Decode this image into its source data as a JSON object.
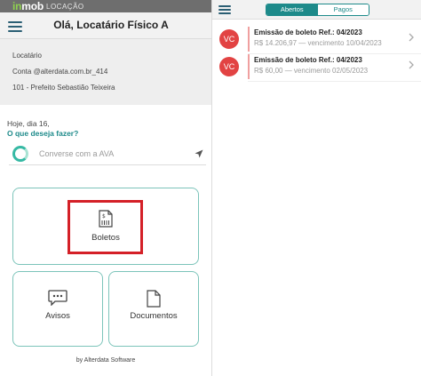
{
  "brand": {
    "logo_prefix": "in",
    "logo_rest": "mob",
    "logo_sub": "LOCAÇÃO"
  },
  "left": {
    "title": "Olá, Locatário Físico A",
    "info": {
      "role": "Locatário",
      "account": "Conta @alterdata.com.br_414",
      "address": "101 - Prefeito Sebastião Teixeira"
    },
    "today": "Hoje, dia 16,",
    "question": "O que deseja fazer?",
    "chat_placeholder": "Converse com a AVA",
    "cards": {
      "boletos": "Boletos",
      "avisos": "Avisos",
      "documentos": "Documentos"
    },
    "footer": "by Alterdata Software"
  },
  "right": {
    "tabs": {
      "open": "Abertos",
      "paid": "Pagos"
    },
    "active_tab": "Abertos",
    "items": [
      {
        "avatar": "VC",
        "title": "Emissão de boleto Ref.: 04/2023",
        "subtitle": "R$ 14.206,97 — vencimento 10/04/2023"
      },
      {
        "avatar": "VC",
        "title": "Emissão de boleto Ref.: 04/2023",
        "subtitle": "R$ 60,00 — vencimento 02/05/2023"
      }
    ]
  },
  "colors": {
    "accent": "#1d8a8a",
    "avatar": "#e24343",
    "highlight": "#d42027",
    "card_border": "#7cc4ba"
  }
}
